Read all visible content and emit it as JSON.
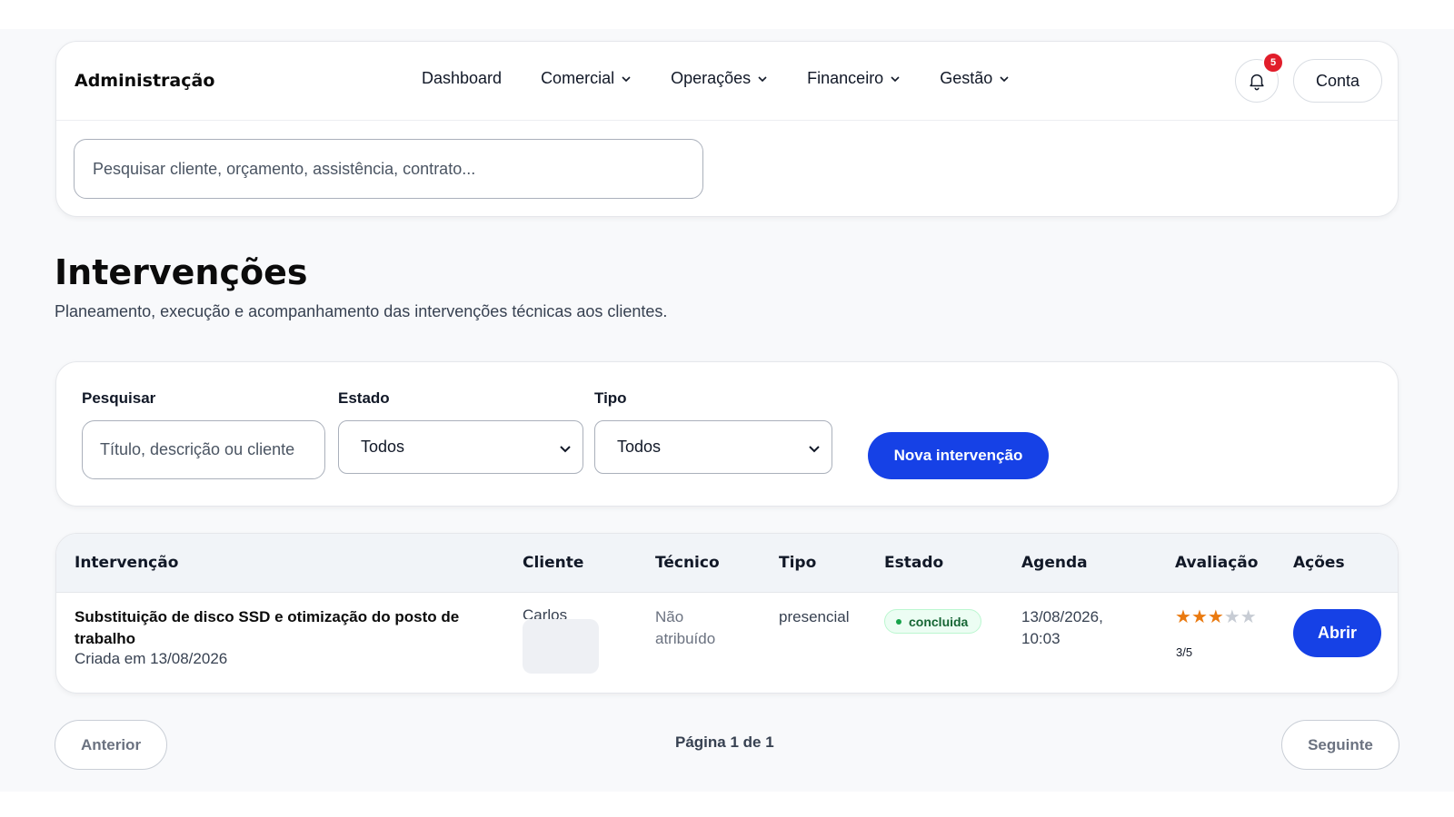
{
  "header": {
    "brand": "Administração",
    "nav": [
      {
        "label": "Dashboard",
        "has_dropdown": false
      },
      {
        "label": "Comercial",
        "has_dropdown": true
      },
      {
        "label": "Operações",
        "has_dropdown": true
      },
      {
        "label": "Financeiro",
        "has_dropdown": true
      },
      {
        "label": "Gestão",
        "has_dropdown": true
      }
    ],
    "notifications": {
      "icon": "bell-icon",
      "count": "5"
    },
    "account_label": "Conta",
    "search_placeholder": "Pesquisar cliente, orçamento, assistência, contrato..."
  },
  "page": {
    "title": "Intervenções",
    "subtitle": "Planeamento, execução e acompanhamento das intervenções técnicas aos clientes."
  },
  "filters": {
    "search_label": "Pesquisar",
    "search_placeholder": "Título, descrição ou cliente",
    "status_label": "Estado",
    "status_value": "Todos",
    "type_label": "Tipo",
    "type_value": "Todos",
    "new_button": "Nova intervenção"
  },
  "table": {
    "columns": [
      "Intervenção",
      "Cliente",
      "Técnico",
      "Tipo",
      "Estado",
      "Agenda",
      "Avaliação",
      "Ações"
    ],
    "rows": [
      {
        "title": "Substituição de disco SSD e otimização do posto de trabalho",
        "created": "Criada em 13/08/2026",
        "client": "Carlos",
        "technician": "Não atribuído",
        "type": "presencial",
        "status": "concluida",
        "agenda": "13/08/2026, 10:03",
        "rating_value": 3,
        "rating_max": 5,
        "rating_text": "3/5",
        "action": "Abrir"
      }
    ]
  },
  "pagination": {
    "prev": "Anterior",
    "info": "Página 1 de 1",
    "next": "Seguinte"
  },
  "colors": {
    "primary": "#1641e6",
    "badge_red": "#e11d2a",
    "status_success": "#16a34a",
    "star_on": "#ea7a10",
    "star_off": "#c7ccd4"
  }
}
